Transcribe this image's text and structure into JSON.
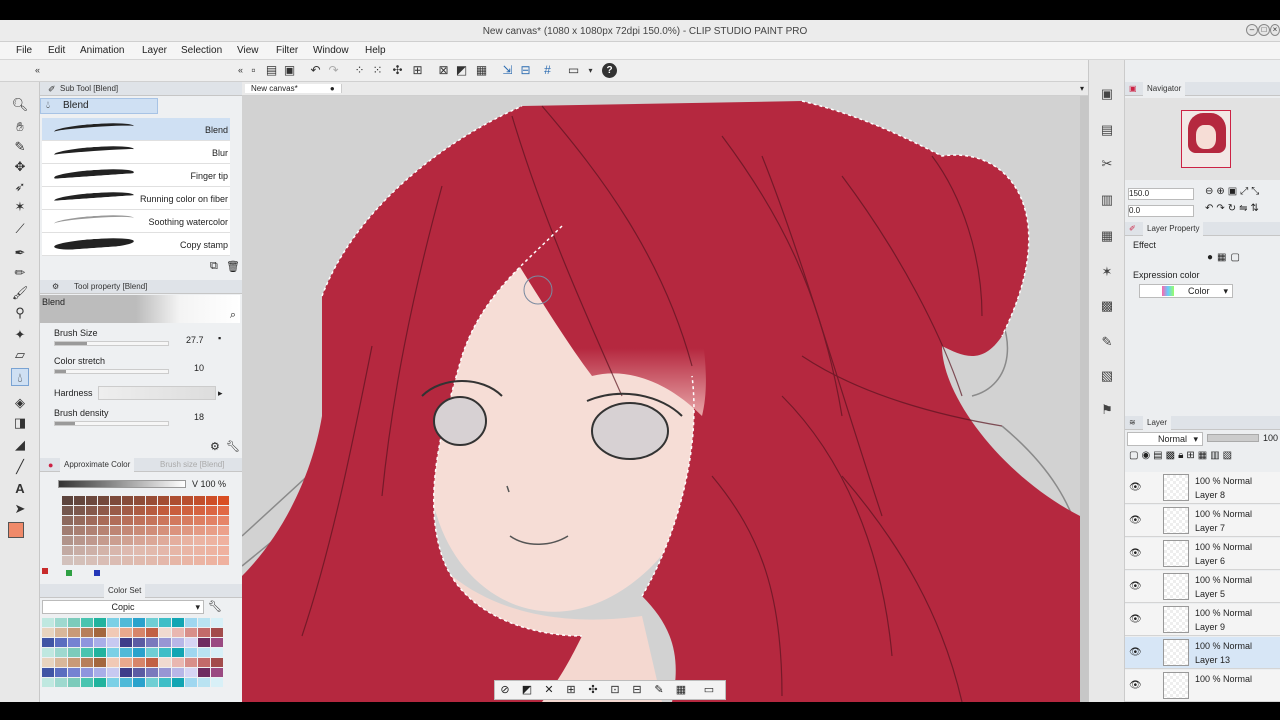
{
  "window": {
    "title": "New canvas* (1080 x 1080px 72dpi 150.0%) - CLIP STUDIO PAINT PRO"
  },
  "menu": [
    "File",
    "Edit",
    "Animation",
    "Layer",
    "Selection",
    "View",
    "Filter",
    "Window",
    "Help"
  ],
  "sub_tool": {
    "header": "Sub Tool [Blend]",
    "group": "Blend",
    "brushes": [
      "Blend",
      "Blur",
      "Finger tip",
      "Running color on fiber",
      "Soothing watercolor",
      "Copy stamp"
    ],
    "selected": "Blend"
  },
  "tool_property": {
    "header": "Tool property [Blend]",
    "name": "Blend",
    "brush_size_label": "Brush Size",
    "brush_size": "27.7",
    "brush_size_frac": 0.28,
    "color_stretch_label": "Color stretch",
    "color_stretch": "10",
    "color_stretch_frac": 0.1,
    "hardness_label": "Hardness",
    "brush_density_label": "Brush density",
    "brush_density": "18",
    "brush_density_frac": 0.18
  },
  "color_panel": {
    "tab_active": "Approximate Color",
    "tab_other": "Brush size [Blend]",
    "value_label": "V 100 %",
    "current_color": "#f08a6a"
  },
  "color_set": {
    "tab": "Color Set",
    "set_name": "Copic"
  },
  "canvas": {
    "tab": "New canvas*"
  },
  "navigator": {
    "title": "Navigator",
    "zoom": "150.0",
    "rotate": "0.0"
  },
  "layer_property": {
    "title": "Layer Property",
    "effect_label": "Effect",
    "expression_label": "Expression color",
    "expression_value": "Color"
  },
  "layer_panel": {
    "title": "Layer",
    "blend_mode": "Normal",
    "opacity": "100",
    "layers": [
      {
        "pct": "100 %",
        "mode": "Normal",
        "name": "Layer 8"
      },
      {
        "pct": "100 %",
        "mode": "Normal",
        "name": "Layer 7"
      },
      {
        "pct": "100 %",
        "mode": "Normal",
        "name": "Layer 6"
      },
      {
        "pct": "100 %",
        "mode": "Normal",
        "name": "Layer 5"
      },
      {
        "pct": "100 %",
        "mode": "Normal",
        "name": "Layer 9"
      },
      {
        "pct": "100 %",
        "mode": "Normal",
        "name": "Layer 13"
      },
      {
        "pct": "100 %",
        "mode": "Normal",
        "name": ""
      }
    ],
    "selected": "Layer 13"
  },
  "colors": {
    "hair": "#b5283f",
    "skin": "#f6ddd6",
    "accent": "#e8f0f8"
  }
}
